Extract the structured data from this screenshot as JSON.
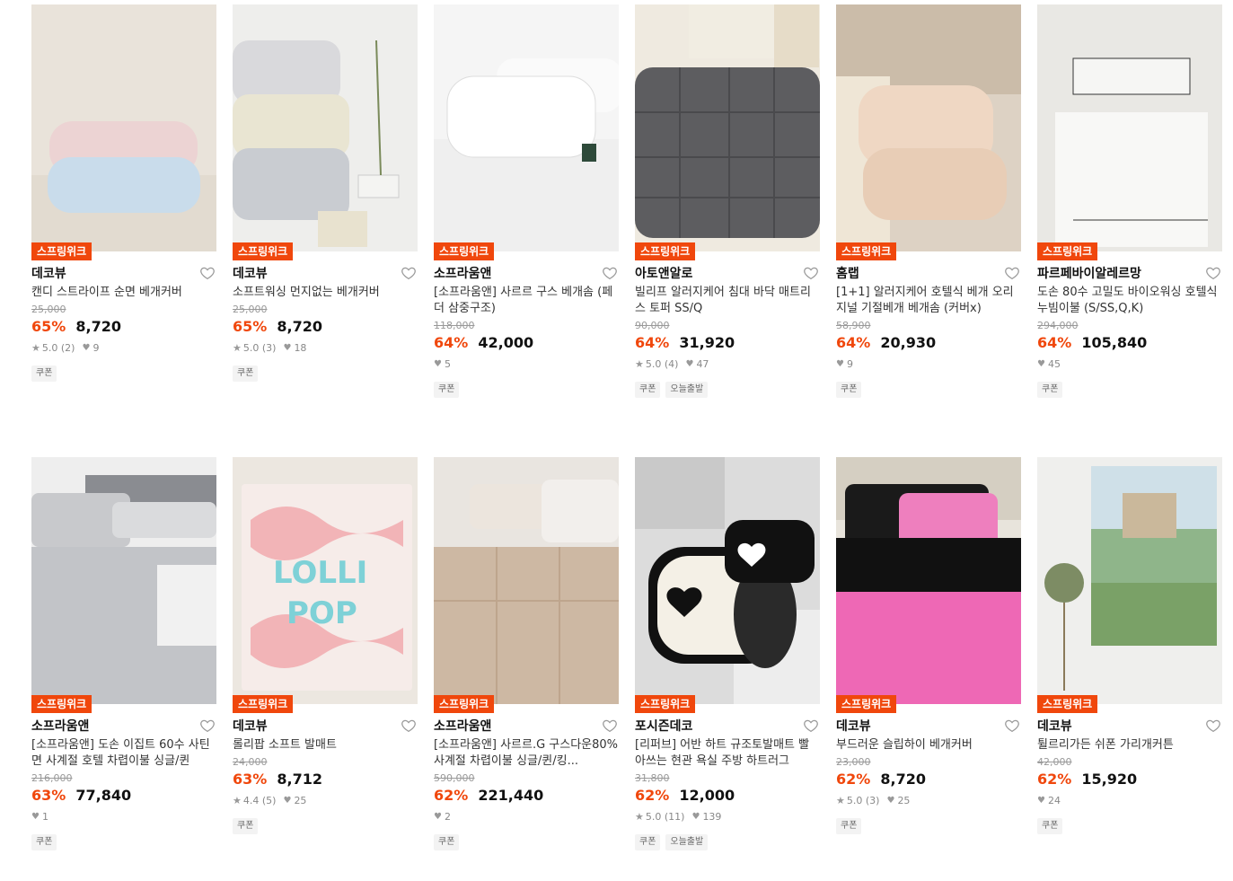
{
  "badge_label": "스프링위크",
  "colors": {
    "accent": "#f0470c",
    "badge_bg": "#f0470c"
  },
  "products": [
    {
      "brand": "데코뷰",
      "title": "캔디 스트라이프 순면 베개커버",
      "orig": "25,000",
      "disc": "65%",
      "price": "8,720",
      "rating": "5.0",
      "reviews": "(2)",
      "likes": "9",
      "tags": [
        "쿠폰"
      ]
    },
    {
      "brand": "데코뷰",
      "title": "소프트워싱 먼지없는 베개커버",
      "orig": "25,000",
      "disc": "65%",
      "price": "8,720",
      "rating": "5.0",
      "reviews": "(3)",
      "likes": "18",
      "tags": [
        "쿠폰"
      ]
    },
    {
      "brand": "소프라움앤",
      "title": "[소프라움앤] 사르르 구스 베개솜 (페더 삼중구조)",
      "orig": "118,000",
      "disc": "64%",
      "price": "42,000",
      "rating": "",
      "reviews": "",
      "likes": "5",
      "tags": [
        "쿠폰"
      ]
    },
    {
      "brand": "아토앤알로",
      "title": "빌리프 알러지케어 침대 바닥 매트리스 토퍼 SS/Q",
      "orig": "90,000",
      "disc": "64%",
      "price": "31,920",
      "rating": "5.0",
      "reviews": "(4)",
      "likes": "47",
      "tags": [
        "쿠폰",
        "오늘출발"
      ]
    },
    {
      "brand": "홈랩",
      "title": "[1+1] 알러지케어 호텔식 베개 오리지널 기절베개 베개솜 (커버x)",
      "orig": "58,900",
      "disc": "64%",
      "price": "20,930",
      "rating": "",
      "reviews": "",
      "likes": "9",
      "tags": [
        "쿠폰"
      ]
    },
    {
      "brand": "파르페바이알레르망",
      "title": "도손 80수 고밀도 바이오워싱 호텔식 누빔이불 (S/SS,Q,K)",
      "orig": "294,000",
      "disc": "64%",
      "price": "105,840",
      "rating": "",
      "reviews": "",
      "likes": "45",
      "tags": [
        "쿠폰"
      ]
    },
    {
      "brand": "소프라움앤",
      "title": "[소프라움앤] 도손 이집트 60수 사틴면 사계절 호텔 차렵이불 싱글/퀸",
      "orig": "216,000",
      "disc": "63%",
      "price": "77,840",
      "rating": "",
      "reviews": "",
      "likes": "1",
      "tags": [
        "쿠폰"
      ]
    },
    {
      "brand": "데코뷰",
      "title": "롤리팝 소프트 발매트",
      "orig": "24,000",
      "disc": "63%",
      "price": "8,712",
      "rating": "4.4",
      "reviews": "(5)",
      "likes": "25",
      "tags": [
        "쿠폰"
      ]
    },
    {
      "brand": "소프라움앤",
      "title": "[소프라움앤] 사르르.G 구스다운80% 사계절 차렵이불 싱글/퀸/킹...",
      "orig": "590,000",
      "disc": "62%",
      "price": "221,440",
      "rating": "",
      "reviews": "",
      "likes": "2",
      "tags": [
        "쿠폰"
      ]
    },
    {
      "brand": "포시즌데코",
      "title": "[리퍼브] 어반 하트 규조토발매트 빨아쓰는 현관 욕실 주방 하트러그",
      "orig": "31,800",
      "disc": "62%",
      "price": "12,000",
      "rating": "5.0",
      "reviews": "(11)",
      "likes": "139",
      "tags": [
        "쿠폰",
        "오늘출발"
      ]
    },
    {
      "brand": "데코뷰",
      "title": "부드러운 슬립하이 베개커버",
      "orig": "23,000",
      "disc": "62%",
      "price": "8,720",
      "rating": "5.0",
      "reviews": "(3)",
      "likes": "25",
      "tags": [
        "쿠폰"
      ]
    },
    {
      "brand": "데코뷰",
      "title": "튈르리가든 쉬폰 가리개커튼",
      "orig": "42,000",
      "disc": "62%",
      "price": "15,920",
      "rating": "",
      "reviews": "",
      "likes": "24",
      "tags": [
        "쿠폰"
      ]
    }
  ]
}
